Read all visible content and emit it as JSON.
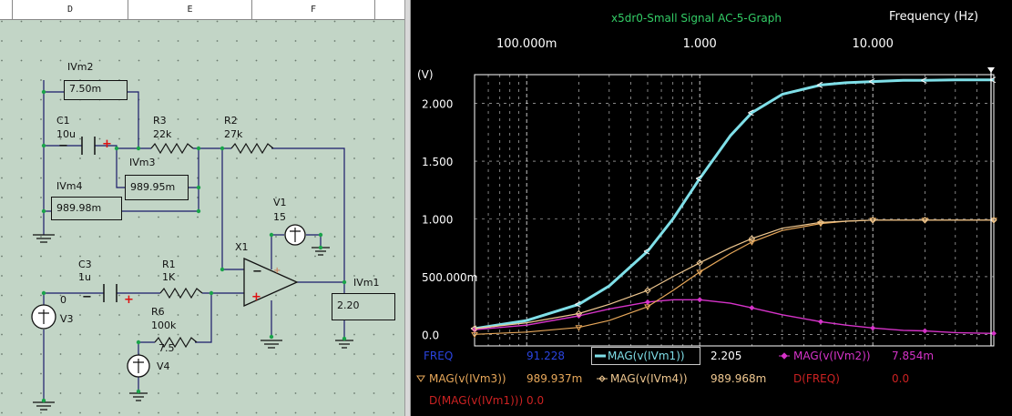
{
  "schematic": {
    "columns": [
      "D",
      "E",
      "F"
    ],
    "labels": {
      "ivm2": "IVm2",
      "c1": "C1",
      "c1_val": "10u",
      "r3": "R3",
      "r3_val": "22k",
      "r2": "R2",
      "r2_val": "27k",
      "ivm3": "IVm3",
      "ivm4": "IVm4",
      "v1": "V1",
      "v1_val": "15",
      "x1": "X1",
      "c3": "C3",
      "c3_val": "1u",
      "r1": "R1",
      "r1_val": "1K",
      "r6": "R6",
      "r6_val": "100k",
      "node0": "0",
      "v3": "V3",
      "node75": "7.5",
      "v4": "V4",
      "ivm1": "IVm1"
    },
    "meters": {
      "ivm2": "7.50m",
      "ivm3": "989.95m",
      "ivm4": "989.98m",
      "ivm1": "2.20"
    }
  },
  "graph": {
    "title": "x5dr0-Small Signal AC-5-Graph",
    "x_axis_title": "Frequency   (Hz)",
    "y_axis_unit": "(V)",
    "x_tick_labels": [
      "100.000m",
      "1.000",
      "10.000"
    ],
    "y_tick_labels": [
      "2.000",
      "1.500",
      "1.000",
      "500.000m",
      "0.0"
    ],
    "readout": {
      "freq_label": "FREQ",
      "freq_value": "91.228",
      "s1_label": "MAG(v(IVm1))",
      "s1_value": "2.205",
      "s2_label": "MAG(v(IVm2))",
      "s2_value": "7.854m",
      "s3_label": "MAG(v(IVm3))",
      "s3_value": "989.937m",
      "s4_label": "MAG(v(IVm4))",
      "s4_value": "989.968m",
      "d_freq_label": "D(FREQ)",
      "d_freq_value": "0.0",
      "d_mag_label": "D(MAG(v(IVm1)))",
      "d_mag_value": "0.0"
    },
    "colors": {
      "ivm1": "#7fdfe8",
      "ivm2": "#d633c9",
      "ivm3": "#e8a85a",
      "ivm4": "#f0c890",
      "title": "#33cc66",
      "freq": "#2a44e0",
      "red": "#cc2222",
      "grid": "#ffffff"
    }
  },
  "chart_data": {
    "type": "line",
    "title": "x5dr0-Small Signal AC-5-Graph",
    "xlabel": "Frequency   (Hz)",
    "ylabel": "(V)",
    "x_scale": "log",
    "xlim": [
      0.05,
      50
    ],
    "ylim": [
      -0.1,
      2.25
    ],
    "grid": true,
    "series": [
      {
        "name": "MAG(v(IVm1))",
        "x": [
          0.05,
          0.1,
          0.2,
          0.3,
          0.5,
          0.7,
          1.0,
          1.5,
          2,
          3,
          5,
          7,
          10,
          15,
          20,
          30,
          50
        ],
        "y": [
          0.05,
          0.12,
          0.26,
          0.42,
          0.72,
          1.0,
          1.35,
          1.72,
          1.92,
          2.08,
          2.16,
          2.18,
          2.19,
          2.2,
          2.2,
          2.205,
          2.205
        ]
      },
      {
        "name": "MAG(v(IVm2))",
        "x": [
          0.05,
          0.1,
          0.2,
          0.3,
          0.5,
          0.7,
          1.0,
          1.5,
          2,
          3,
          5,
          7,
          10,
          15,
          20,
          30,
          50
        ],
        "y": [
          0.04,
          0.08,
          0.16,
          0.22,
          0.28,
          0.3,
          0.3,
          0.27,
          0.23,
          0.17,
          0.11,
          0.08,
          0.055,
          0.035,
          0.03,
          0.015,
          0.008
        ]
      },
      {
        "name": "MAG(v(IVm3))",
        "x": [
          0.05,
          0.1,
          0.2,
          0.3,
          0.5,
          0.7,
          1.0,
          1.5,
          2,
          3,
          5,
          7,
          10,
          15,
          20,
          30,
          50
        ],
        "y": [
          0.0,
          0.02,
          0.06,
          0.12,
          0.24,
          0.38,
          0.54,
          0.7,
          0.8,
          0.9,
          0.96,
          0.98,
          0.99,
          0.99,
          0.99,
          0.99,
          0.99
        ]
      },
      {
        "name": "MAG(v(IVm4))",
        "x": [
          0.05,
          0.1,
          0.2,
          0.3,
          0.5,
          0.7,
          1.0,
          1.5,
          2,
          3,
          5,
          7,
          10,
          15,
          20,
          30,
          50
        ],
        "y": [
          0.05,
          0.1,
          0.18,
          0.26,
          0.38,
          0.5,
          0.62,
          0.75,
          0.83,
          0.92,
          0.97,
          0.98,
          0.99,
          0.99,
          0.99,
          0.99,
          0.99
        ]
      }
    ],
    "cursor_x": 91.228
  }
}
